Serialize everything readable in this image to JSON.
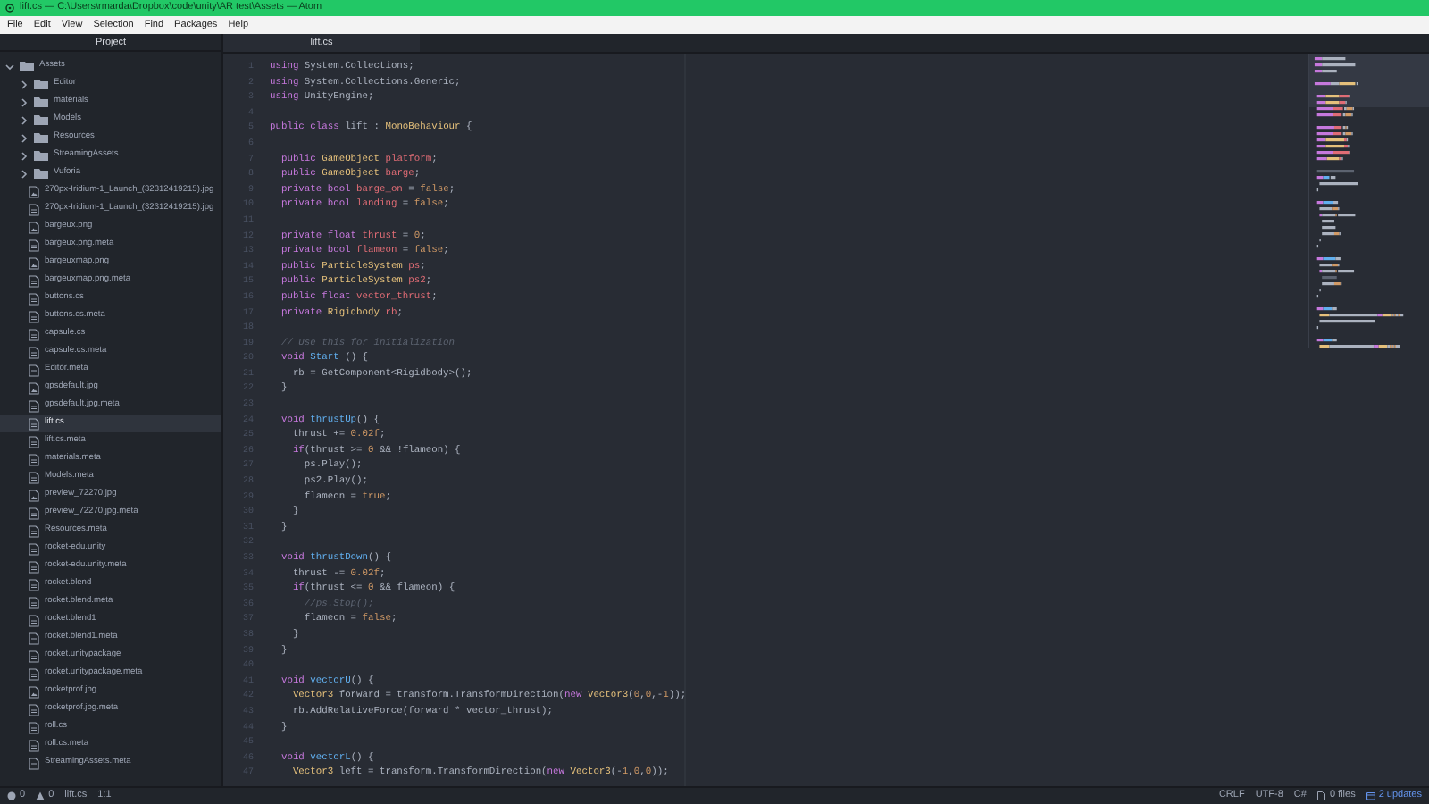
{
  "window": {
    "title": "lift.cs — C:\\Users\\rmarda\\Dropbox\\code\\unity\\AR test\\Assets — Atom"
  },
  "menu": [
    "File",
    "Edit",
    "View",
    "Selection",
    "Find",
    "Packages",
    "Help"
  ],
  "tree_panel": {
    "title": "Project",
    "items": [
      {
        "label": "Assets",
        "kind": "folder",
        "expanded": true,
        "selected": false,
        "children": [
          {
            "label": "Editor",
            "kind": "folder",
            "expanded": false,
            "selected": false
          },
          {
            "label": "materials",
            "kind": "folder",
            "expanded": false,
            "selected": false
          },
          {
            "label": "Models",
            "kind": "folder",
            "expanded": false,
            "selected": false
          },
          {
            "label": "Resources",
            "kind": "folder",
            "expanded": false,
            "selected": false
          },
          {
            "label": "StreamingAssets",
            "kind": "folder",
            "expanded": false,
            "selected": false
          },
          {
            "label": "Vuforia",
            "kind": "folder",
            "expanded": false,
            "selected": false
          },
          {
            "label": "270px-Iridium-1_Launch_(32312419215).jpg",
            "kind": "image",
            "selected": false
          },
          {
            "label": "270px-Iridium-1_Launch_(32312419215).jpg",
            "kind": "file",
            "selected": false
          },
          {
            "label": "bargeux.png",
            "kind": "image",
            "selected": false
          },
          {
            "label": "bargeux.png.meta",
            "kind": "file",
            "selected": false
          },
          {
            "label": "bargeuxmap.png",
            "kind": "image",
            "selected": false
          },
          {
            "label": "bargeuxmap.png.meta",
            "kind": "file",
            "selected": false
          },
          {
            "label": "buttons.cs",
            "kind": "file",
            "selected": false
          },
          {
            "label": "buttons.cs.meta",
            "kind": "file",
            "selected": false
          },
          {
            "label": "capsule.cs",
            "kind": "file",
            "selected": false
          },
          {
            "label": "capsule.cs.meta",
            "kind": "file",
            "selected": false
          },
          {
            "label": "Editor.meta",
            "kind": "file",
            "selected": false
          },
          {
            "label": "gpsdefault.jpg",
            "kind": "image",
            "selected": false
          },
          {
            "label": "gpsdefault.jpg.meta",
            "kind": "file",
            "selected": false
          },
          {
            "label": "lift.cs",
            "kind": "file",
            "selected": true
          },
          {
            "label": "lift.cs.meta",
            "kind": "file",
            "selected": false
          },
          {
            "label": "materials.meta",
            "kind": "file",
            "selected": false
          },
          {
            "label": "Models.meta",
            "kind": "file",
            "selected": false
          },
          {
            "label": "preview_72270.jpg",
            "kind": "image",
            "selected": false
          },
          {
            "label": "preview_72270.jpg.meta",
            "kind": "file",
            "selected": false
          },
          {
            "label": "Resources.meta",
            "kind": "file",
            "selected": false
          },
          {
            "label": "rocket-edu.unity",
            "kind": "file",
            "selected": false
          },
          {
            "label": "rocket-edu.unity.meta",
            "kind": "file",
            "selected": false
          },
          {
            "label": "rocket.blend",
            "kind": "file",
            "selected": false
          },
          {
            "label": "rocket.blend.meta",
            "kind": "file",
            "selected": false
          },
          {
            "label": "rocket.blend1",
            "kind": "file",
            "selected": false
          },
          {
            "label": "rocket.blend1.meta",
            "kind": "file",
            "selected": false
          },
          {
            "label": "rocket.unitypackage",
            "kind": "file",
            "selected": false
          },
          {
            "label": "rocket.unitypackage.meta",
            "kind": "file",
            "selected": false
          },
          {
            "label": "rocketprof.jpg",
            "kind": "image",
            "selected": false
          },
          {
            "label": "rocketprof.jpg.meta",
            "kind": "file",
            "selected": false
          },
          {
            "label": "roll.cs",
            "kind": "file",
            "selected": false
          },
          {
            "label": "roll.cs.meta",
            "kind": "file",
            "selected": false
          },
          {
            "label": "StreamingAssets.meta",
            "kind": "file",
            "selected": false
          }
        ]
      }
    ]
  },
  "editor": {
    "tabs": [
      {
        "label": "lift.cs",
        "selected": true
      }
    ],
    "lines": [
      {
        "num": "1",
        "tokens": [
          {
            "kind": "keyword",
            "text": "using "
          },
          {
            "kind": "plain",
            "text": "System.Collections;"
          }
        ]
      },
      {
        "num": "2",
        "tokens": [
          {
            "kind": "keyword",
            "text": "using "
          },
          {
            "kind": "plain",
            "text": "System.Collections.Generic;"
          }
        ]
      },
      {
        "num": "3",
        "tokens": [
          {
            "kind": "keyword",
            "text": "using "
          },
          {
            "kind": "plain",
            "text": "UnityEngine;"
          }
        ]
      },
      {
        "num": "4"
      },
      {
        "num": "5",
        "tokens": [
          {
            "kind": "keyword",
            "text": "public class "
          },
          {
            "kind": "plain",
            "text": "lift : "
          },
          {
            "kind": "type",
            "text": "MonoBehaviour"
          },
          {
            "kind": "plain",
            "text": " {"
          }
        ]
      },
      {
        "num": "6"
      },
      {
        "num": "7",
        "tokens": [
          {
            "kind": "keyword",
            "text": "  public "
          },
          {
            "kind": "type",
            "text": "GameObject "
          },
          {
            "kind": "variable",
            "text": "platform"
          },
          {
            "kind": "plain",
            "text": ";"
          }
        ]
      },
      {
        "num": "8",
        "tokens": [
          {
            "kind": "keyword",
            "text": "  public "
          },
          {
            "kind": "type",
            "text": "GameObject "
          },
          {
            "kind": "variable",
            "text": "barge"
          },
          {
            "kind": "plain",
            "text": ";"
          }
        ]
      },
      {
        "num": "9",
        "tokens": [
          {
            "kind": "keyword",
            "text": "  private bool "
          },
          {
            "kind": "variable",
            "text": "barge_on"
          },
          {
            "kind": "plain",
            "text": " = "
          },
          {
            "kind": "constant",
            "text": "false"
          },
          {
            "kind": "plain",
            "text": ";"
          }
        ]
      },
      {
        "num": "10",
        "tokens": [
          {
            "kind": "keyword",
            "text": "  private bool "
          },
          {
            "kind": "variable",
            "text": "landing"
          },
          {
            "kind": "plain",
            "text": " = "
          },
          {
            "kind": "constant",
            "text": "false"
          },
          {
            "kind": "plain",
            "text": ";"
          }
        ]
      },
      {
        "num": "11"
      },
      {
        "num": "12",
        "tokens": [
          {
            "kind": "keyword",
            "text": "  private float "
          },
          {
            "kind": "variable",
            "text": "thrust"
          },
          {
            "kind": "plain",
            "text": " = "
          },
          {
            "kind": "constant",
            "text": "0"
          },
          {
            "kind": "plain",
            "text": ";"
          }
        ]
      },
      {
        "num": "13",
        "tokens": [
          {
            "kind": "keyword",
            "text": "  private bool "
          },
          {
            "kind": "variable",
            "text": "flameon"
          },
          {
            "kind": "plain",
            "text": " = "
          },
          {
            "kind": "constant",
            "text": "false"
          },
          {
            "kind": "plain",
            "text": ";"
          }
        ]
      },
      {
        "num": "14",
        "tokens": [
          {
            "kind": "keyword",
            "text": "  public "
          },
          {
            "kind": "type",
            "text": "ParticleSystem "
          },
          {
            "kind": "variable",
            "text": "ps"
          },
          {
            "kind": "plain",
            "text": ";"
          }
        ]
      },
      {
        "num": "15",
        "tokens": [
          {
            "kind": "keyword",
            "text": "  public "
          },
          {
            "kind": "type",
            "text": "ParticleSystem "
          },
          {
            "kind": "variable",
            "text": "ps2"
          },
          {
            "kind": "plain",
            "text": ";"
          }
        ]
      },
      {
        "num": "16",
        "tokens": [
          {
            "kind": "keyword",
            "text": "  public float "
          },
          {
            "kind": "variable",
            "text": "vector_thrust"
          },
          {
            "kind": "plain",
            "text": ";"
          }
        ]
      },
      {
        "num": "17",
        "tokens": [
          {
            "kind": "keyword",
            "text": "  private "
          },
          {
            "kind": "type",
            "text": "Rigidbody "
          },
          {
            "kind": "variable",
            "text": "rb"
          },
          {
            "kind": "plain",
            "text": ";"
          }
        ]
      },
      {
        "num": "18"
      },
      {
        "num": "19",
        "tokens": [
          {
            "kind": "comment",
            "text": "  // Use this for initialization"
          }
        ]
      },
      {
        "num": "20",
        "tokens": [
          {
            "kind": "keyword",
            "text": "  void "
          },
          {
            "kind": "function",
            "text": "Start"
          },
          {
            "kind": "plain",
            "text": " () {"
          }
        ]
      },
      {
        "num": "21",
        "tokens": [
          {
            "kind": "plain",
            "text": "    rb = GetComponent<Rigidbody>();"
          }
        ]
      },
      {
        "num": "22",
        "tokens": [
          {
            "kind": "plain",
            "text": "  }"
          }
        ]
      },
      {
        "num": "23"
      },
      {
        "num": "24",
        "tokens": [
          {
            "kind": "keyword",
            "text": "  void "
          },
          {
            "kind": "function",
            "text": "thrustUp"
          },
          {
            "kind": "plain",
            "text": "() {"
          }
        ]
      },
      {
        "num": "25",
        "tokens": [
          {
            "kind": "plain",
            "text": "    thrust += "
          },
          {
            "kind": "constant",
            "text": "0.02f"
          },
          {
            "kind": "plain",
            "text": ";"
          }
        ]
      },
      {
        "num": "26",
        "tokens": [
          {
            "kind": "keyword",
            "text": "    if"
          },
          {
            "kind": "plain",
            "text": "(thrust >= "
          },
          {
            "kind": "constant",
            "text": "0"
          },
          {
            "kind": "plain",
            "text": " && !flameon) {"
          }
        ]
      },
      {
        "num": "27",
        "tokens": [
          {
            "kind": "plain",
            "text": "      ps.Play();"
          }
        ]
      },
      {
        "num": "28",
        "tokens": [
          {
            "kind": "plain",
            "text": "      ps2.Play();"
          }
        ]
      },
      {
        "num": "29",
        "tokens": [
          {
            "kind": "plain",
            "text": "      flameon = "
          },
          {
            "kind": "constant",
            "text": "true"
          },
          {
            "kind": "plain",
            "text": ";"
          }
        ]
      },
      {
        "num": "30",
        "tokens": [
          {
            "kind": "plain",
            "text": "    }"
          }
        ]
      },
      {
        "num": "31",
        "tokens": [
          {
            "kind": "plain",
            "text": "  }"
          }
        ]
      },
      {
        "num": "32"
      },
      {
        "num": "33",
        "tokens": [
          {
            "kind": "keyword",
            "text": "  void "
          },
          {
            "kind": "function",
            "text": "thrustDown"
          },
          {
            "kind": "plain",
            "text": "() {"
          }
        ]
      },
      {
        "num": "34",
        "tokens": [
          {
            "kind": "plain",
            "text": "    thrust -= "
          },
          {
            "kind": "constant",
            "text": "0.02f"
          },
          {
            "kind": "plain",
            "text": ";"
          }
        ]
      },
      {
        "num": "35",
        "tokens": [
          {
            "kind": "keyword",
            "text": "    if"
          },
          {
            "kind": "plain",
            "text": "(thrust <= "
          },
          {
            "kind": "constant",
            "text": "0"
          },
          {
            "kind": "plain",
            "text": " && flameon) {"
          }
        ]
      },
      {
        "num": "36",
        "tokens": [
          {
            "kind": "comment",
            "text": "      //ps.Stop();"
          }
        ]
      },
      {
        "num": "37",
        "tokens": [
          {
            "kind": "plain",
            "text": "      flameon = "
          },
          {
            "kind": "constant",
            "text": "false"
          },
          {
            "kind": "plain",
            "text": ";"
          }
        ]
      },
      {
        "num": "38",
        "tokens": [
          {
            "kind": "plain",
            "text": "    }"
          }
        ]
      },
      {
        "num": "39",
        "tokens": [
          {
            "kind": "plain",
            "text": "  }"
          }
        ]
      },
      {
        "num": "40"
      },
      {
        "num": "41",
        "tokens": [
          {
            "kind": "keyword",
            "text": "  void "
          },
          {
            "kind": "function",
            "text": "vectorU"
          },
          {
            "kind": "plain",
            "text": "() {"
          }
        ]
      },
      {
        "num": "42",
        "tokens": [
          {
            "kind": "type",
            "text": "    Vector3 "
          },
          {
            "kind": "plain",
            "text": "forward = transform.TransformDirection("
          },
          {
            "kind": "keyword",
            "text": "new "
          },
          {
            "kind": "type",
            "text": "Vector3"
          },
          {
            "kind": "plain",
            "text": "("
          },
          {
            "kind": "constant",
            "text": "0"
          },
          {
            "kind": "plain",
            "text": ","
          },
          {
            "kind": "constant",
            "text": "0"
          },
          {
            "kind": "plain",
            "text": ",-"
          },
          {
            "kind": "constant",
            "text": "1"
          },
          {
            "kind": "plain",
            "text": "));"
          }
        ]
      },
      {
        "num": "43",
        "tokens": [
          {
            "kind": "plain",
            "text": "    rb.AddRelativeForce(forward * vector_thrust);"
          }
        ]
      },
      {
        "num": "44",
        "tokens": [
          {
            "kind": "plain",
            "text": "  }"
          }
        ]
      },
      {
        "num": "45"
      },
      {
        "num": "46",
        "tokens": [
          {
            "kind": "keyword",
            "text": "  void "
          },
          {
            "kind": "function",
            "text": "vectorL"
          },
          {
            "kind": "plain",
            "text": "() {"
          }
        ]
      },
      {
        "num": "47",
        "tokens": [
          {
            "kind": "type",
            "text": "    Vector3 "
          },
          {
            "kind": "plain",
            "text": "left = transform.TransformDirection("
          },
          {
            "kind": "keyword",
            "text": "new "
          },
          {
            "kind": "type",
            "text": "Vector3"
          },
          {
            "kind": "plain",
            "text": "(-"
          },
          {
            "kind": "constant",
            "text": "1"
          },
          {
            "kind": "plain",
            "text": ","
          },
          {
            "kind": "constant",
            "text": "0"
          },
          {
            "kind": "plain",
            "text": ","
          },
          {
            "kind": "constant",
            "text": "0"
          },
          {
            "kind": "plain",
            "text": "));"
          }
        ]
      }
    ]
  },
  "status_bar": {
    "errors": "0",
    "warnings": "0",
    "file": "lift.cs",
    "cursor": "1:1",
    "line_ending": "CRLF",
    "encoding": "UTF-8",
    "grammar": "C#",
    "git": "0 files",
    "updates": "2 updates"
  }
}
